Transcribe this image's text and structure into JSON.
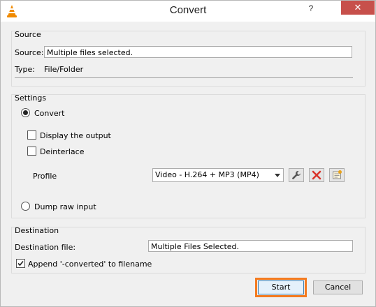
{
  "window": {
    "title": "Convert",
    "help_glyph": "?",
    "close_glyph": "✕"
  },
  "source": {
    "group_title": "Source",
    "source_label": "Source:",
    "source_value": "Multiple files selected.",
    "type_label": "Type:",
    "type_value": "File/Folder"
  },
  "settings": {
    "group_title": "Settings",
    "convert_label": "Convert",
    "convert_selected": true,
    "display_output_label": "Display the output",
    "display_output_checked": false,
    "deinterlace_label": "Deinterlace",
    "deinterlace_checked": false,
    "profile_label": "Profile",
    "profile_value": "Video - H.264 + MP3 (MP4)",
    "profile_buttons": [
      "wrench-icon",
      "delete-icon",
      "new-profile-icon"
    ],
    "dump_raw_label": "Dump raw input",
    "dump_raw_selected": false
  },
  "destination": {
    "group_title": "Destination",
    "file_label": "Destination file:",
    "file_value": "Multiple Files Selected.",
    "append_label": "Append '-converted' to filename",
    "append_checked": true
  },
  "buttons": {
    "start_label": "Start",
    "cancel_label": "Cancel"
  },
  "colors": {
    "highlight": "#f47b20",
    "close": "#c7504b",
    "delete_red": "#d9342b"
  }
}
